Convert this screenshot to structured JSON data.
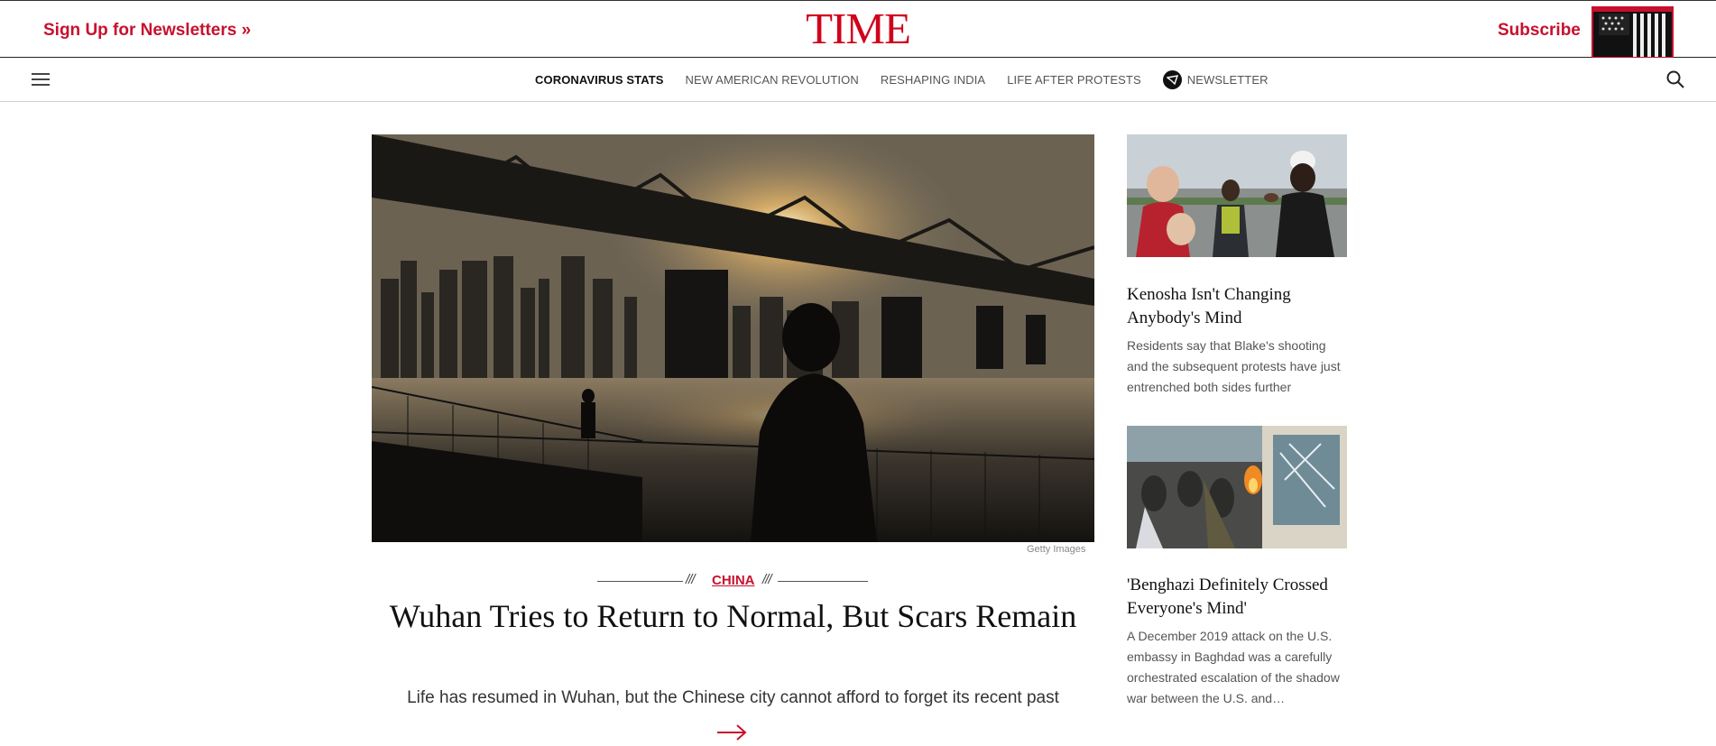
{
  "header": {
    "newsletter_link": "Sign Up for Newsletters »",
    "logo": "TIME",
    "subscribe": "Subscribe"
  },
  "nav": {
    "items": [
      {
        "label": "CORONAVIRUS STATS"
      },
      {
        "label": "NEW AMERICAN REVOLUTION"
      },
      {
        "label": "RESHAPING INDIA"
      },
      {
        "label": "LIFE AFTER PROTESTS"
      }
    ],
    "newsletter": "NEWSLETTER"
  },
  "hero": {
    "credit": "Getty Images",
    "kicker": "CHINA",
    "title": "Wuhan Tries to Return to Normal, But Scars Remain",
    "description": "Life has resumed in Wuhan, but the Chinese city cannot afford to forget its recent past"
  },
  "sidebar": [
    {
      "title": "Kenosha Isn't Changing Anybody's Mind",
      "description": "Residents say that Blake's shooting and the subsequent protests have just entrenched both sides further"
    },
    {
      "title": "'Benghazi Definitely Crossed Everyone's Mind'",
      "description": "A December 2019 attack on the U.S. embassy in Baghdad was a carefully orchestrated escalation of the shadow war between the U.S. and…"
    }
  ],
  "colors": {
    "brand_red": "#c8102e",
    "logo_red": "#d0021b"
  },
  "icons": [
    "menu-icon",
    "newsletter-icon",
    "search-icon",
    "arrow-right-icon"
  ]
}
